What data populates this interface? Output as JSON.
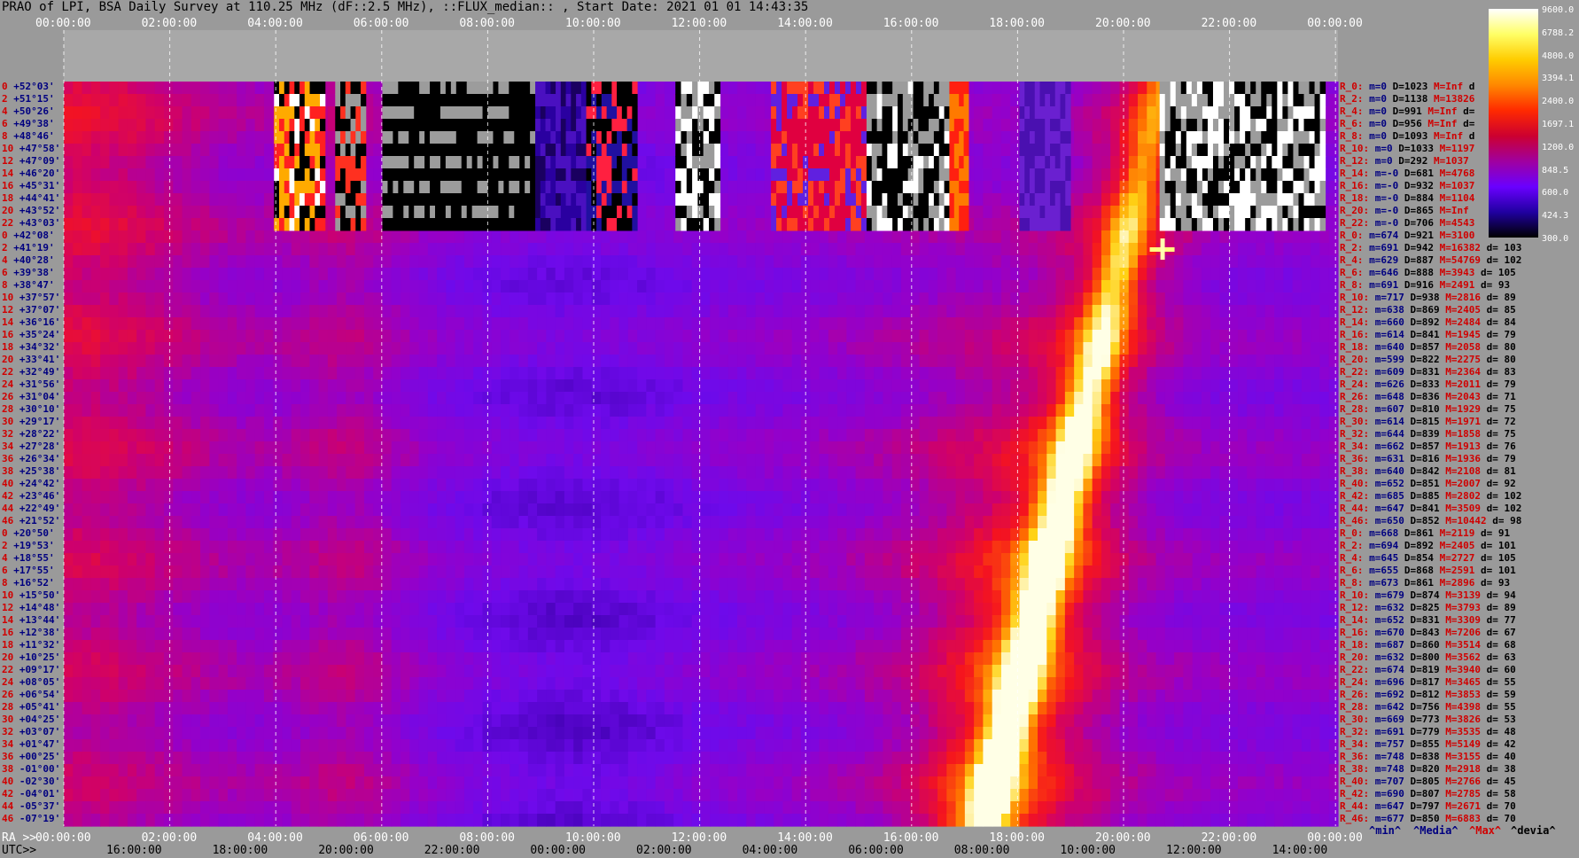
{
  "title": "PRAO of LPI, BSA Daily Survey at 110.25 MHz (dF::2.5 MHz), ::FLUX_median:: , Start Date: 2021 01 01 14:43:35",
  "top_ticks": [
    "00:00:00",
    "02:00:00",
    "04:00:00",
    "06:00:00",
    "08:00:00",
    "10:00:00",
    "12:00:00",
    "14:00:00",
    "16:00:00",
    "18:00:00",
    "20:00:00",
    "22:00:00",
    "00:00:00"
  ],
  "bottom": {
    "ra_prefix": "RA >>",
    "utc_prefix": "UTC>>",
    "ra_ticks": [
      "00:00:00",
      "02:00:00",
      "04:00:00",
      "06:00:00",
      "08:00:00",
      "10:00:00",
      "12:00:00",
      "14:00:00",
      "16:00:00",
      "18:00:00",
      "20:00:00",
      "22:00:00",
      "00:00:00"
    ],
    "utc_ticks": [
      "16:00:00",
      "18:00:00",
      "20:00:00",
      "22:00:00",
      "00:00:00",
      "02:00:00",
      "04:00:00",
      "06:00:00",
      "08:00:00",
      "10:00:00",
      "12:00:00",
      "14:00:00"
    ]
  },
  "colorbar": {
    "labels": [
      "9600.0",
      "6788.2",
      "4800.0",
      "3394.1",
      "2400.0",
      "1697.1",
      "1200.0",
      "848.5",
      "600.0",
      "424.3",
      "300.0"
    ],
    "colors": [
      "#ffffff",
      "#ffff66",
      "#ffcc00",
      "#ff8800",
      "#ff2a00",
      "#cc0030",
      "#a000a0",
      "#6a00ff",
      "#2000a0",
      "#000000"
    ]
  },
  "legend": {
    "min": "^min^",
    "median": "^Media^",
    "max": "^Max^",
    "dev": "^devia^"
  },
  "declinations": [
    {
      "i": "0",
      "v": "+52°03'"
    },
    {
      "i": "2",
      "v": "+51°15'"
    },
    {
      "i": "4",
      "v": "+50°26'"
    },
    {
      "i": "6",
      "v": "+49°38'"
    },
    {
      "i": "8",
      "v": "+48°46'"
    },
    {
      "i": "10",
      "v": "+47°58'"
    },
    {
      "i": "12",
      "v": "+47°09'"
    },
    {
      "i": "14",
      "v": "+46°20'"
    },
    {
      "i": "16",
      "v": "+45°31'"
    },
    {
      "i": "18",
      "v": "+44°41'"
    },
    {
      "i": "20",
      "v": "+43°52'"
    },
    {
      "i": "22",
      "v": "+43°03'"
    },
    {
      "i": "0",
      "v": "+42°08'"
    },
    {
      "i": "2",
      "v": "+41°19'"
    },
    {
      "i": "4",
      "v": "+40°28'"
    },
    {
      "i": "6",
      "v": "+39°38'"
    },
    {
      "i": "8",
      "v": "+38°47'"
    },
    {
      "i": "10",
      "v": "+37°57'"
    },
    {
      "i": "12",
      "v": "+37°07'"
    },
    {
      "i": "14",
      "v": "+36°16'"
    },
    {
      "i": "16",
      "v": "+35°24'"
    },
    {
      "i": "18",
      "v": "+34°32'"
    },
    {
      "i": "20",
      "v": "+33°41'"
    },
    {
      "i": "22",
      "v": "+32°49'"
    },
    {
      "i": "24",
      "v": "+31°56'"
    },
    {
      "i": "26",
      "v": "+31°04'"
    },
    {
      "i": "28",
      "v": "+30°10'"
    },
    {
      "i": "30",
      "v": "+29°17'"
    },
    {
      "i": "32",
      "v": "+28°22'"
    },
    {
      "i": "34",
      "v": "+27°28'"
    },
    {
      "i": "36",
      "v": "+26°34'"
    },
    {
      "i": "38",
      "v": "+25°38'"
    },
    {
      "i": "40",
      "v": "+24°42'"
    },
    {
      "i": "42",
      "v": "+23°46'"
    },
    {
      "i": "44",
      "v": "+22°49'"
    },
    {
      "i": "46",
      "v": "+21°52'"
    },
    {
      "i": "0",
      "v": "+20°50'"
    },
    {
      "i": "2",
      "v": "+19°53'"
    },
    {
      "i": "4",
      "v": "+18°55'"
    },
    {
      "i": "6",
      "v": "+17°55'"
    },
    {
      "i": "8",
      "v": "+16°52'"
    },
    {
      "i": "10",
      "v": "+15°50'"
    },
    {
      "i": "12",
      "v": "+14°48'"
    },
    {
      "i": "14",
      "v": "+13°44'"
    },
    {
      "i": "16",
      "v": "+12°38'"
    },
    {
      "i": "18",
      "v": "+11°32'"
    },
    {
      "i": "20",
      "v": "+10°25'"
    },
    {
      "i": "22",
      "v": "+09°17'"
    },
    {
      "i": "24",
      "v": "+08°05'"
    },
    {
      "i": "26",
      "v": "+06°54'"
    },
    {
      "i": "28",
      "v": "+05°41'"
    },
    {
      "i": "30",
      "v": "+04°25'"
    },
    {
      "i": "32",
      "v": "+03°07'"
    },
    {
      "i": "34",
      "v": "+01°47'"
    },
    {
      "i": "36",
      "v": "+00°25'"
    },
    {
      "i": "38",
      "v": "-01°00'"
    },
    {
      "i": "40",
      "v": "-02°30'"
    },
    {
      "i": "42",
      "v": "-04°01'"
    },
    {
      "i": "44",
      "v": "-05°37'"
    },
    {
      "i": "46",
      "v": "-07°19'"
    }
  ],
  "stats": [
    {
      "lab": "R_0:",
      "m": "m=0",
      "d": "D=1023",
      "M": "M=Inf",
      "dev": "d"
    },
    {
      "lab": "R_2:",
      "m": "m=0",
      "d": "D=1138",
      "M": "M=13826",
      "dev": ""
    },
    {
      "lab": "R_4:",
      "m": "m=0",
      "d": "D=991",
      "M": "M=Inf",
      "dev": "d="
    },
    {
      "lab": "R_6:",
      "m": "m=0",
      "d": "D=956",
      "M": "M=Inf",
      "dev": "d="
    },
    {
      "lab": "R_8:",
      "m": "m=0",
      "d": "D=1093",
      "M": "M=Inf",
      "dev": "d"
    },
    {
      "lab": "R_10:",
      "m": "m=0",
      "d": "D=1033",
      "M": "M=1197",
      "dev": ""
    },
    {
      "lab": "R_12:",
      "m": "m=0",
      "d": "D=292",
      "M": "M=1037",
      "dev": ""
    },
    {
      "lab": "R_14:",
      "m": "m=-0",
      "d": "D=681",
      "M": "M=4768",
      "dev": ""
    },
    {
      "lab": "R_16:",
      "m": "m=-0",
      "d": "D=932",
      "M": "M=1037",
      "dev": ""
    },
    {
      "lab": "R_18:",
      "m": "m=-0",
      "d": "D=884",
      "M": "M=1104",
      "dev": ""
    },
    {
      "lab": "R_20:",
      "m": "m=-0",
      "d": "D=865",
      "M": "M=Inf",
      "dev": ""
    },
    {
      "lab": "R_22:",
      "m": "m=-0",
      "d": "D=706",
      "M": "M=4543",
      "dev": ""
    },
    {
      "lab": "R_0:",
      "m": "m=674",
      "d": "D=921",
      "M": "M=3100",
      "dev": ""
    },
    {
      "lab": "R_2:",
      "m": "m=691",
      "d": "D=942",
      "M": "M=16382",
      "dev": "d= 103"
    },
    {
      "lab": "R_4:",
      "m": "m=629",
      "d": "D=887",
      "M": "M=54769",
      "dev": "d= 102"
    },
    {
      "lab": "R_6:",
      "m": "m=646",
      "d": "D=888",
      "M": "M=3943",
      "dev": "d= 105"
    },
    {
      "lab": "R_8:",
      "m": "m=691",
      "d": "D=916",
      "M": "M=2491",
      "dev": "d= 93"
    },
    {
      "lab": "R_10:",
      "m": "m=717",
      "d": "D=938",
      "M": "M=2816",
      "dev": "d= 89"
    },
    {
      "lab": "R_12:",
      "m": "m=638",
      "d": "D=869",
      "M": "M=2405",
      "dev": "d= 85"
    },
    {
      "lab": "R_14:",
      "m": "m=660",
      "d": "D=892",
      "M": "M=2484",
      "dev": "d= 84"
    },
    {
      "lab": "R_16:",
      "m": "m=614",
      "d": "D=841",
      "M": "M=1945",
      "dev": "d= 79"
    },
    {
      "lab": "R_18:",
      "m": "m=640",
      "d": "D=857",
      "M": "M=2058",
      "dev": "d= 80"
    },
    {
      "lab": "R_20:",
      "m": "m=599",
      "d": "D=822",
      "M": "M=2275",
      "dev": "d= 80"
    },
    {
      "lab": "R_22:",
      "m": "m=609",
      "d": "D=831",
      "M": "M=2364",
      "dev": "d= 83"
    },
    {
      "lab": "R_24:",
      "m": "m=626",
      "d": "D=833",
      "M": "M=2011",
      "dev": "d= 79"
    },
    {
      "lab": "R_26:",
      "m": "m=648",
      "d": "D=836",
      "M": "M=2043",
      "dev": "d= 71"
    },
    {
      "lab": "R_28:",
      "m": "m=607",
      "d": "D=810",
      "M": "M=1929",
      "dev": "d= 75"
    },
    {
      "lab": "R_30:",
      "m": "m=614",
      "d": "D=815",
      "M": "M=1971",
      "dev": "d= 72"
    },
    {
      "lab": "R_32:",
      "m": "m=644",
      "d": "D=839",
      "M": "M=1858",
      "dev": "d= 75"
    },
    {
      "lab": "R_34:",
      "m": "m=662",
      "d": "D=857",
      "M": "M=1913",
      "dev": "d= 76"
    },
    {
      "lab": "R_36:",
      "m": "m=631",
      "d": "D=816",
      "M": "M=1936",
      "dev": "d= 79"
    },
    {
      "lab": "R_38:",
      "m": "m=640",
      "d": "D=842",
      "M": "M=2108",
      "dev": "d= 81"
    },
    {
      "lab": "R_40:",
      "m": "m=652",
      "d": "D=851",
      "M": "M=2007",
      "dev": "d= 92"
    },
    {
      "lab": "R_42:",
      "m": "m=685",
      "d": "D=885",
      "M": "M=2802",
      "dev": "d= 102"
    },
    {
      "lab": "R_44:",
      "m": "m=647",
      "d": "D=841",
      "M": "M=3509",
      "dev": "d= 102"
    },
    {
      "lab": "R_46:",
      "m": "m=650",
      "d": "D=852",
      "M": "M=10442",
      "dev": "d= 98"
    },
    {
      "lab": "R_0:",
      "m": "m=668",
      "d": "D=861",
      "M": "M=2119",
      "dev": "d= 91"
    },
    {
      "lab": "R_2:",
      "m": "m=694",
      "d": "D=892",
      "M": "M=2405",
      "dev": "d= 101"
    },
    {
      "lab": "R_4:",
      "m": "m=645",
      "d": "D=854",
      "M": "M=2727",
      "dev": "d= 105"
    },
    {
      "lab": "R_6:",
      "m": "m=655",
      "d": "D=868",
      "M": "M=2591",
      "dev": "d= 101"
    },
    {
      "lab": "R_8:",
      "m": "m=673",
      "d": "D=861",
      "M": "M=2896",
      "dev": "d= 93"
    },
    {
      "lab": "R_10:",
      "m": "m=679",
      "d": "D=874",
      "M": "M=3139",
      "dev": "d= 94"
    },
    {
      "lab": "R_12:",
      "m": "m=632",
      "d": "D=825",
      "M": "M=3793",
      "dev": "d= 89"
    },
    {
      "lab": "R_14:",
      "m": "m=652",
      "d": "D=831",
      "M": "M=3309",
      "dev": "d= 77"
    },
    {
      "lab": "R_16:",
      "m": "m=670",
      "d": "D=843",
      "M": "M=7206",
      "dev": "d= 67"
    },
    {
      "lab": "R_18:",
      "m": "m=687",
      "d": "D=860",
      "M": "M=3514",
      "dev": "d= 68"
    },
    {
      "lab": "R_20:",
      "m": "m=632",
      "d": "D=800",
      "M": "M=3562",
      "dev": "d= 63"
    },
    {
      "lab": "R_22:",
      "m": "m=674",
      "d": "D=819",
      "M": "M=3940",
      "dev": "d= 60"
    },
    {
      "lab": "R_24:",
      "m": "m=696",
      "d": "D=817",
      "M": "M=3465",
      "dev": "d= 55"
    },
    {
      "lab": "R_26:",
      "m": "m=692",
      "d": "D=812",
      "M": "M=3853",
      "dev": "d= 59"
    },
    {
      "lab": "R_28:",
      "m": "m=642",
      "d": "D=756",
      "M": "M=4398",
      "dev": "d= 55"
    },
    {
      "lab": "R_30:",
      "m": "m=669",
      "d": "D=773",
      "M": "M=3826",
      "dev": "d= 53"
    },
    {
      "lab": "R_32:",
      "m": "m=691",
      "d": "D=779",
      "M": "M=3535",
      "dev": "d= 48"
    },
    {
      "lab": "R_34:",
      "m": "m=757",
      "d": "D=855",
      "M": "M=5149",
      "dev": "d= 42"
    },
    {
      "lab": "R_36:",
      "m": "m=748",
      "d": "D=838",
      "M": "M=3155",
      "dev": "d= 40"
    },
    {
      "lab": "R_38:",
      "m": "m=748",
      "d": "D=820",
      "M": "M=2918",
      "dev": "d= 38"
    },
    {
      "lab": "R_40:",
      "m": "m=707",
      "d": "D=805",
      "M": "M=2766",
      "dev": "d= 45"
    },
    {
      "lab": "R_42:",
      "m": "m=690",
      "d": "D=807",
      "M": "M=2785",
      "dev": "d= 58"
    },
    {
      "lab": "R_44:",
      "m": "m=647",
      "d": "D=797",
      "M": "M=2671",
      "dev": "d= 70"
    },
    {
      "lab": "R_46:",
      "m": "m=677",
      "d": "D=850",
      "M": "M=6883",
      "dev": "d= 70"
    }
  ],
  "chart_data": {
    "type": "heatmap",
    "title": "PRAO of LPI, BSA Daily Survey at 110.25 MHz (dF::2.5 MHz), ::FLUX_median:: , Start Date: 2021 01 01 14:43:35",
    "x_axis_top": "RA",
    "x_axis_bottom": [
      "RA",
      "UTC"
    ],
    "x_range_hours": [
      0,
      24
    ],
    "rows": 60,
    "colorbar_range": [
      300.0,
      9600.0
    ],
    "colorbar_ticks": [
      9600.0,
      6788.2,
      4800.0,
      3394.1,
      2400.0,
      1697.1,
      1200.0,
      848.5,
      600.0,
      424.3,
      300.0
    ],
    "grid": true,
    "features": [
      {
        "name": "bright diagonal ridge",
        "ra_start_hours": 17.6,
        "ra_end_hours": 21.0
      },
      {
        "name": "bright point",
        "ra_hours": 20.0,
        "dec": "+41°19'"
      }
    ]
  }
}
